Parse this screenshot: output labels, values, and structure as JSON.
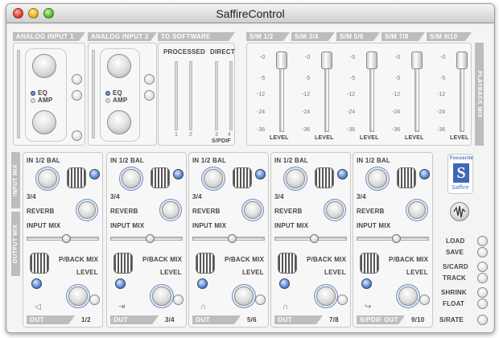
{
  "window": {
    "title": "SaffireControl"
  },
  "tabs": {
    "analog_input_1": "ANALOG INPUT 1",
    "analog_input_2": "ANALOG INPUT 2",
    "to_software": "TO SOFTWARE",
    "sm12": "S/M 1/2",
    "sm34": "S/M 3/4",
    "sm56": "S/M 5/6",
    "sm78": "S/M 7/8",
    "sm910": "S/M 9/10"
  },
  "analog": {
    "eq": "EQ",
    "amp": "AMP"
  },
  "software": {
    "processed": "PROCESSED",
    "direct": "DIRECT",
    "spdif": "S/PDIF",
    "ticks": [
      "1",
      "2",
      "3",
      "4"
    ]
  },
  "playback": {
    "label": "PLAYBACK MIX",
    "scale": [
      "-0",
      "-5",
      "-12",
      "-24",
      "-36"
    ],
    "level": "LEVEL"
  },
  "side_labels": {
    "input_mix": "INPUT MIX",
    "output_mix": "OUTPUT MIX"
  },
  "strip": {
    "in_bal": "IN 1/2 BAL",
    "ch34": "3/4",
    "reverb": "REVERB",
    "input_mix": "INPUT MIX",
    "pback_mix": "P/BACK MIX",
    "level": "LEVEL"
  },
  "outputs": [
    {
      "out": "OUT",
      "num": "1/2"
    },
    {
      "out": "OUT",
      "num": "3/4"
    },
    {
      "out": "OUT",
      "num": "5/6"
    },
    {
      "out": "OUT",
      "num": "7/8"
    },
    {
      "out": "S/PDIF OUT",
      "num": "9/10"
    }
  ],
  "logo": {
    "brand": "Focusrite",
    "letter": "S",
    "product": "Saffire"
  },
  "right_buttons": {
    "load": "LOAD",
    "save": "SAVE",
    "scard": "S/CARD",
    "track": "TRACK",
    "shrink": "SHRINK",
    "float": "FLOAT",
    "srate": "S/RATE"
  }
}
